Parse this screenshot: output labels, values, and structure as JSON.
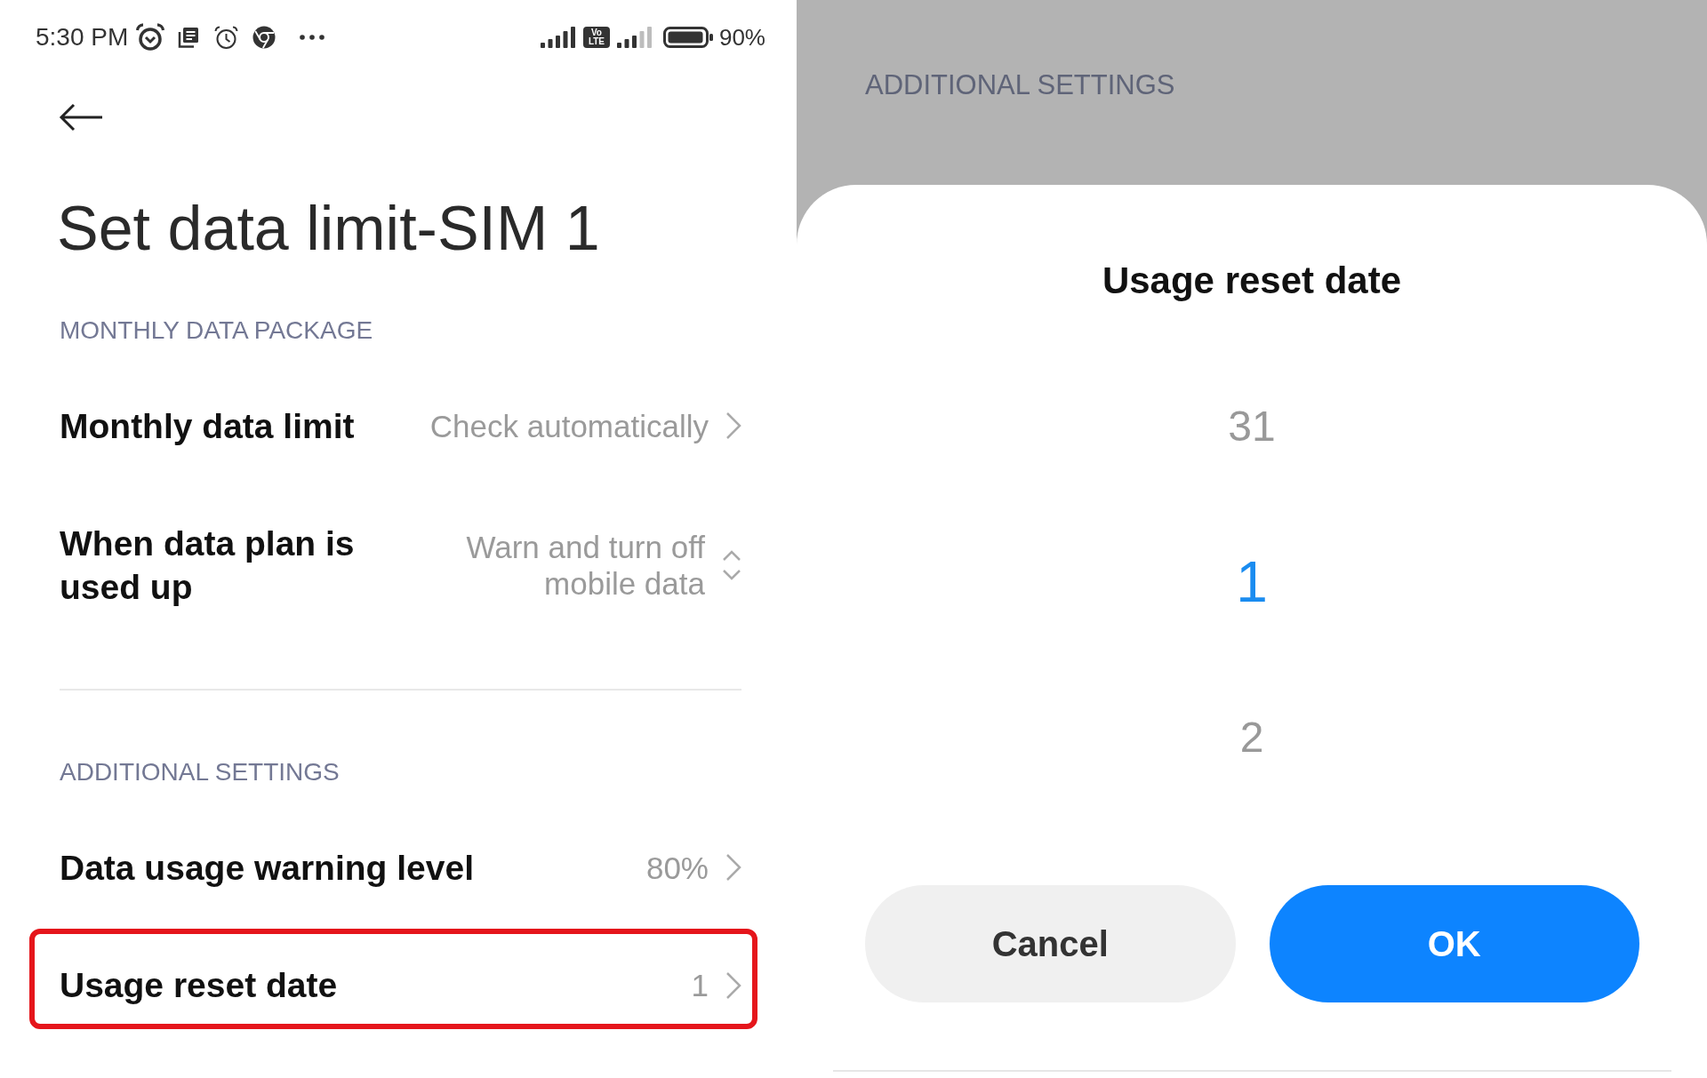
{
  "status_bar": {
    "time": "5:30 PM",
    "network_badge": [
      "Vo",
      "LTE"
    ],
    "battery": "90%"
  },
  "settings_screen": {
    "title": "Set data limit-SIM 1",
    "sections": [
      {
        "header": "MONTHLY DATA PACKAGE",
        "rows": [
          {
            "kind": "link",
            "label": "Monthly data limit",
            "value": "Check automatically",
            "highlighted": false
          },
          {
            "kind": "select",
            "label": "When data plan is used up",
            "value": "Warn and turn off mobile data",
            "highlighted": false
          }
        ]
      },
      {
        "header": "ADDITIONAL SETTINGS",
        "rows": [
          {
            "kind": "link",
            "label": "Data usage warning level",
            "value": "80%",
            "highlighted": false
          },
          {
            "kind": "link",
            "label": "Usage reset date",
            "value": "1",
            "highlighted": true
          }
        ]
      }
    ]
  },
  "dimmed_screen": {
    "header": "ADDITIONAL SETTINGS"
  },
  "dialog": {
    "title": "Usage reset date",
    "options": [
      {
        "label": "31",
        "selected": false
      },
      {
        "label": "1",
        "selected": true
      },
      {
        "label": "2",
        "selected": false
      }
    ],
    "buttons": [
      {
        "kind": "secondary",
        "label": "Cancel"
      },
      {
        "kind": "primary",
        "label": "OK"
      }
    ]
  }
}
